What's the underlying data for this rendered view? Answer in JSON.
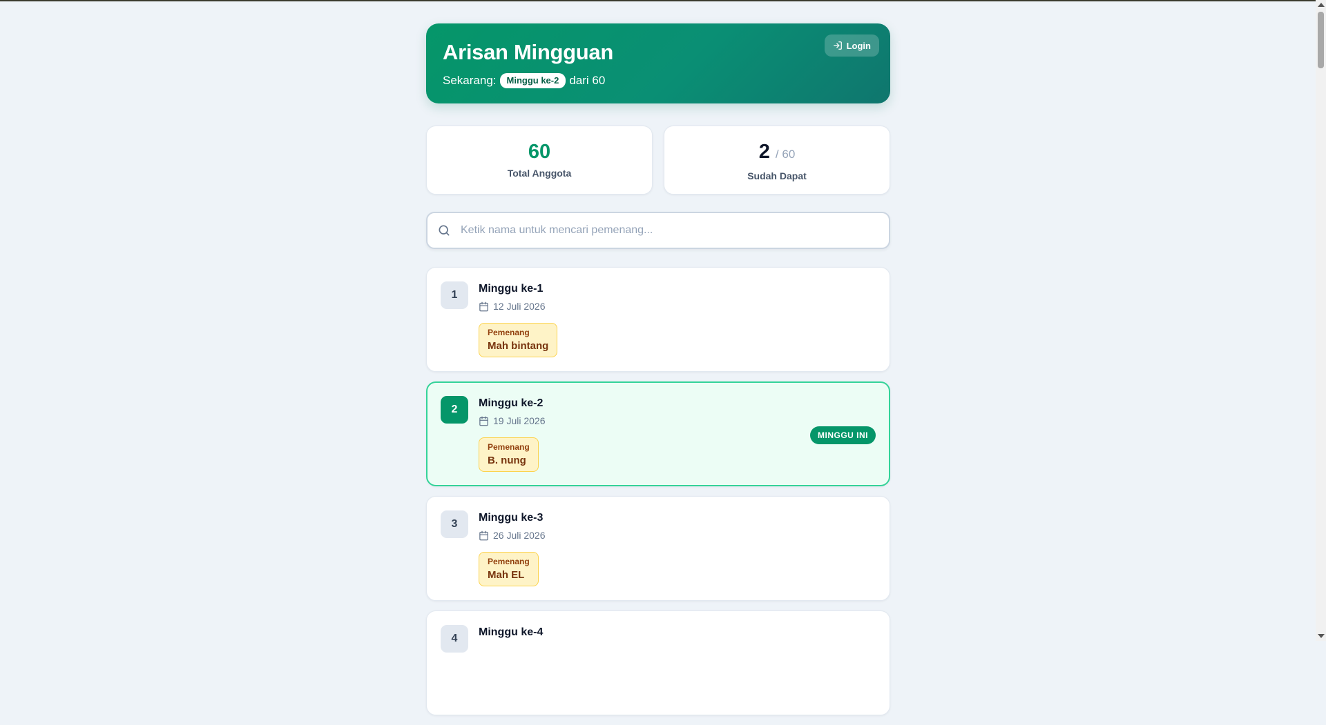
{
  "header": {
    "title": "Arisan Mingguan",
    "now_prefix": "Sekarang:",
    "current_week_label": "Minggu ke-2",
    "of_text": "dari 60",
    "login_label": "Login",
    "login_icon": "login-icon"
  },
  "stats": {
    "total_members_value": "60",
    "total_members_label": "Total Anggota",
    "received_value": "2",
    "received_of": "/ 60",
    "received_label": "Sudah Dapat"
  },
  "search": {
    "placeholder": "Ketik nama untuk mencari pemenang...",
    "value": "",
    "icon": "search-icon"
  },
  "weeks": [
    {
      "number": "1",
      "title": "Minggu ke-1",
      "date": "12 Juli 2026",
      "winner_label": "Pemenang",
      "winner_name": "Mah bintang"
    },
    {
      "number": "2",
      "title": "Minggu ke-2",
      "date": "19 Juli 2026",
      "winner_label": "Pemenang",
      "winner_name": "B. nung",
      "badge": "MINGGU INI"
    },
    {
      "number": "3",
      "title": "Minggu ke-3",
      "date": "26 Juli 2026",
      "winner_label": "Pemenang",
      "winner_name": "Mah EL"
    },
    {
      "number": "4",
      "title": "Minggu ke-4"
    }
  ],
  "colors": {
    "brand_green": "#059669",
    "header_gradient_end": "#0f766e",
    "winner_bg": "#fef3c7",
    "current_card_bg": "#ecfdf5",
    "page_bg": "#eef3f8"
  }
}
